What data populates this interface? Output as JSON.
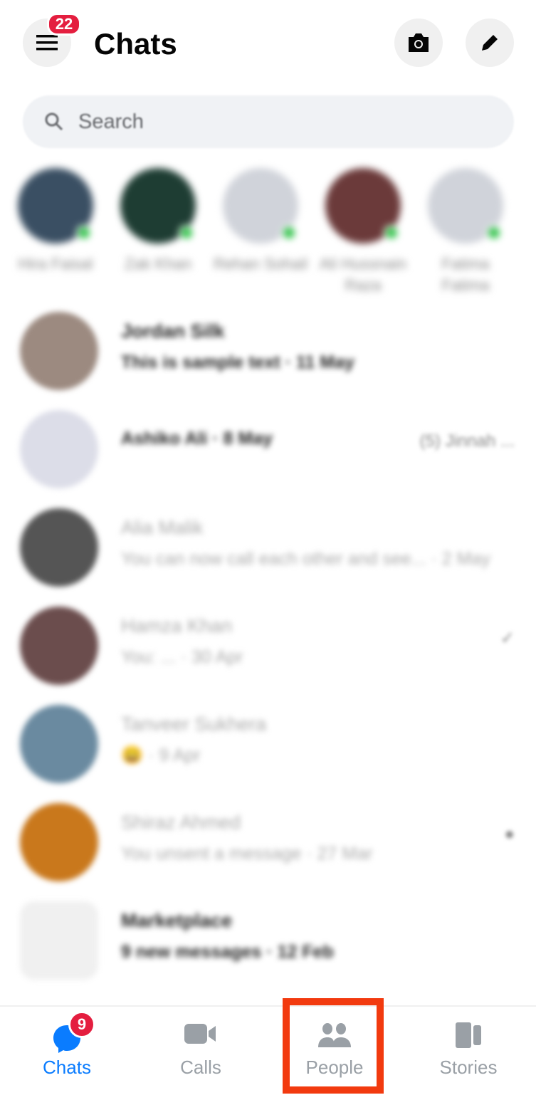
{
  "header": {
    "title": "Chats",
    "menu_badge": "22"
  },
  "search": {
    "placeholder": "Search"
  },
  "stories": [
    {
      "name": "Hira Faisal",
      "color": "#3a4f63"
    },
    {
      "name": "Zak Khan",
      "color": "#1e3d33"
    },
    {
      "name": "Rehan Sohail",
      "color": "#d0d3da"
    },
    {
      "name": "Ali Hussnain Raza",
      "color": "#6b3a3a"
    },
    {
      "name": "Fatima Fatima",
      "color": "#d0d3da"
    }
  ],
  "chats": [
    {
      "name": "Jordan Silk",
      "preview": "This is sample text · 11 May",
      "bold": true,
      "color": "#9c8a80",
      "right": ""
    },
    {
      "name": "",
      "preview": "Ashiko Ali · 8 May",
      "bold": true,
      "color": "#dcdde8",
      "right": "(5) Jinnah ..."
    },
    {
      "name": "Alia Malik",
      "preview": "You can now call each other and see... · 2 May",
      "bold": false,
      "color": "#555",
      "right": ""
    },
    {
      "name": "Hamza Khan",
      "preview": "You: ... · 30 Apr",
      "bold": false,
      "color": "#6b4d4d",
      "right": "✓"
    },
    {
      "name": "Tanveer Sukhera",
      "preview": "😀 · 9 Apr",
      "bold": false,
      "color": "#6a8aa0",
      "right": ""
    },
    {
      "name": "Shiraz Ahmed",
      "preview": "You unsent a message · 27 Mar",
      "bold": false,
      "color": "#c9781c",
      "right": "●"
    },
    {
      "name": "Marketplace",
      "preview": "9 new messages · 12 Feb",
      "bold": true,
      "color": "#f0f0f0",
      "right": ""
    }
  ],
  "nav": {
    "tabs": [
      {
        "label": "Chats",
        "active": true,
        "badge": "9"
      },
      {
        "label": "Calls",
        "active": false
      },
      {
        "label": "People",
        "active": false,
        "highlighted": true
      },
      {
        "label": "Stories",
        "active": false
      }
    ]
  },
  "colors": {
    "accent": "#0a7cff",
    "badge": "#e41e3f",
    "highlight": "#f23a0f",
    "inactive": "#9aa0a6"
  }
}
